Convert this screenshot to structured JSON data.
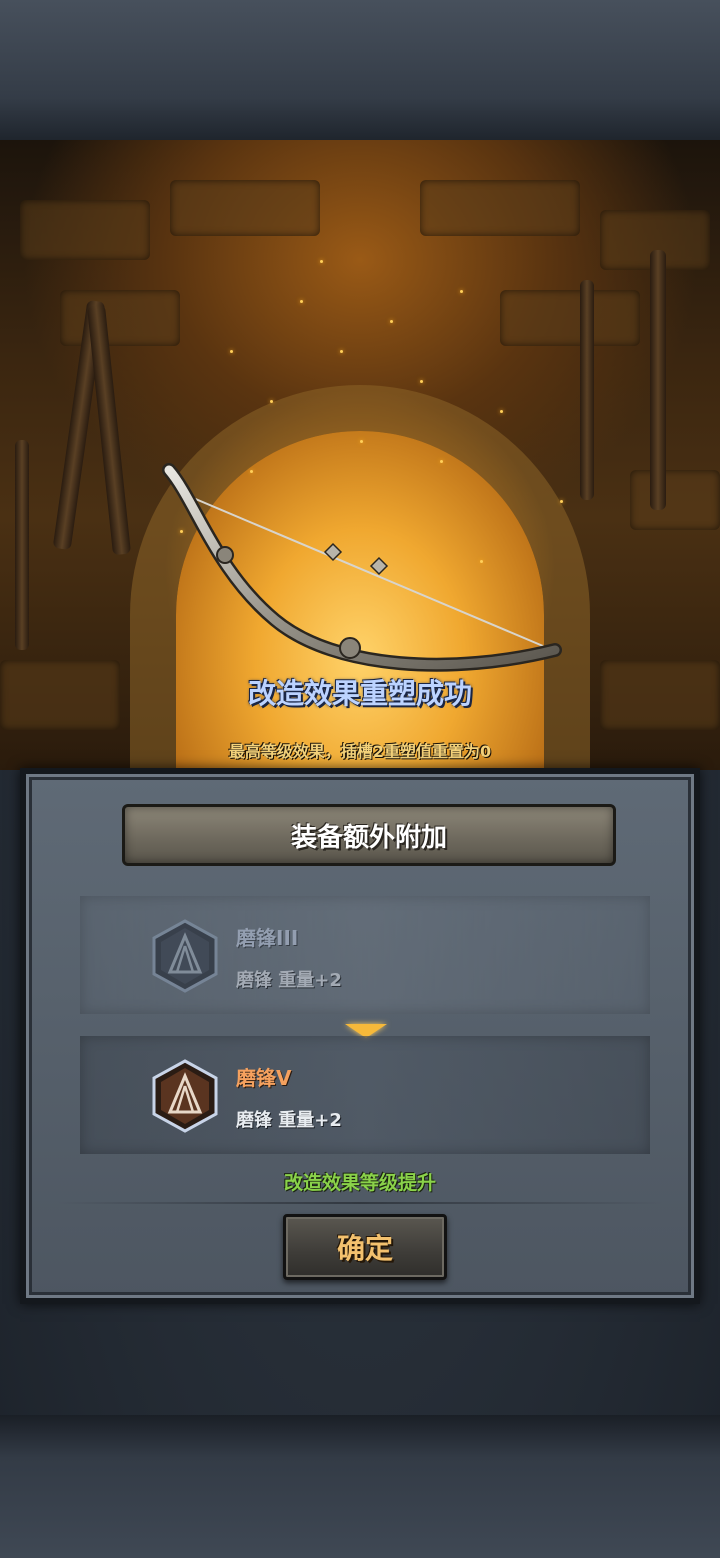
{
  "scene": {
    "title": "改造效果重塑成功",
    "subtitle": "最高等级效果，插槽2重塑值重置为0"
  },
  "panel": {
    "header": "装备额外附加",
    "old_effect": {
      "name": "磨锋III",
      "desc": "磨锋 重量+2",
      "icon": "sharpen-hex-icon"
    },
    "new_effect": {
      "name": "磨锋V",
      "desc": "磨锋 重量+2",
      "icon": "sharpen-hex-icon"
    },
    "upgrade_text": "改造效果等级提升",
    "confirm_label": "确定"
  },
  "colors": {
    "title": "#bcd3ff",
    "subtitle": "#f4d27a",
    "new_name": "#f5a15e",
    "upgrade": "#8ad24a",
    "confirm": "#f3c16e",
    "arrow": "#f6b93a"
  }
}
